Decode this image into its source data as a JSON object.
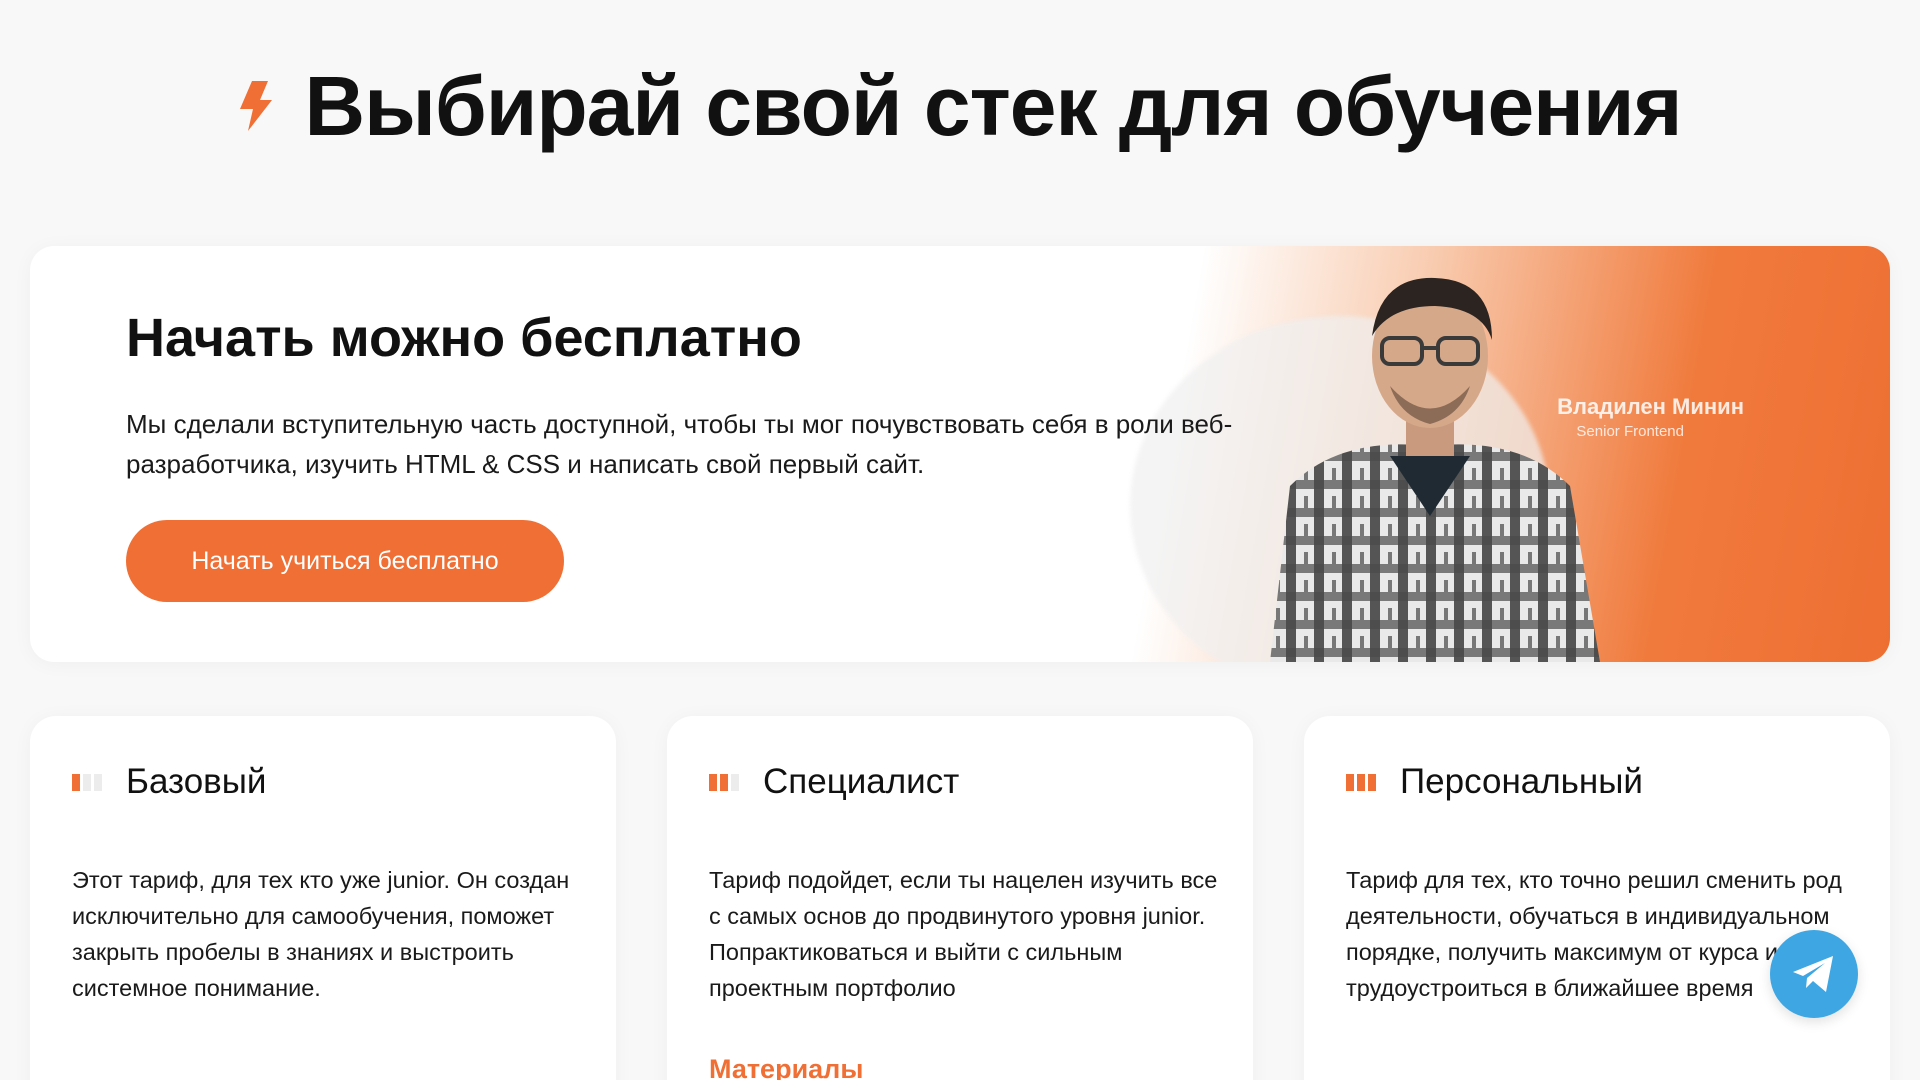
{
  "section": {
    "title": "Выбирай свой стек для обучения",
    "icon": "lightning-icon"
  },
  "promo": {
    "title": "Начать можно бесплатно",
    "description": "Мы сделали вступительную часть доступной, чтобы ты мог почувствовать себя в роли веб-разработчика, изучить HTML & CSS и написать свой первый сайт.",
    "button_label": "Начать учиться бесплатно",
    "mentor_name": "Владилен Минин",
    "mentor_role": "Senior Frontend"
  },
  "tariffs": [
    {
      "title": "Базовый",
      "level": 1,
      "description": "Этот тариф, для тех кто уже junior. Он создан исключительно для самообучения, поможет закрыть пробелы в знаниях и выстроить системное понимание."
    },
    {
      "title": "Специалист",
      "level": 2,
      "description": "Тариф подойдет, если ты нацелен изучить все с самых основ до продвинутого уровня junior. Попрактиковаться и выйти с сильным проектным портфолио",
      "link_label": "Материалы"
    },
    {
      "title": "Персональный",
      "level": 3,
      "description": "Тариф для тех, кто точно решил сменить род деятельности, обучаться в индивидуальном порядке, получить максимум от курса и трудоустроиться в ближайшее время"
    }
  ],
  "colors": {
    "accent": "#ef6f35",
    "telegram": "#3ea6e3"
  },
  "floating": {
    "icon": "telegram-icon"
  }
}
